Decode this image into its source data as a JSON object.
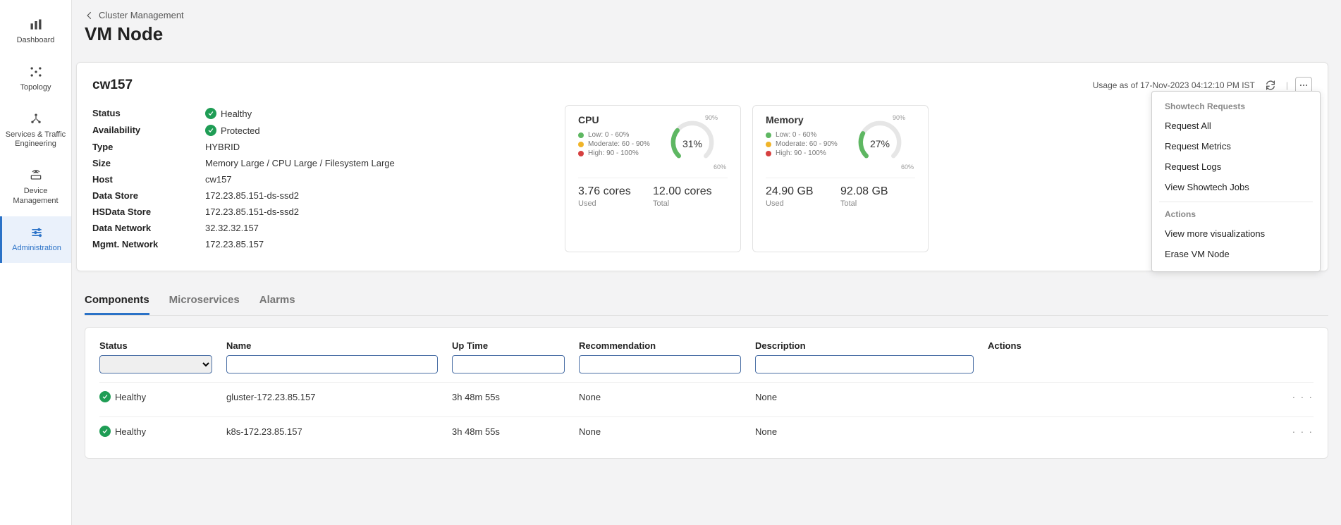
{
  "breadcrumb": "Cluster Management",
  "page_title": "VM Node",
  "sidebar": {
    "items": [
      {
        "label": "Dashboard"
      },
      {
        "label": "Topology"
      },
      {
        "label": "Services & Traffic Engineering"
      },
      {
        "label": "Device Management"
      },
      {
        "label": "Administration"
      }
    ],
    "active_index": 4
  },
  "node": {
    "name": "cw157",
    "usage_as_of": "Usage as of 17-Nov-2023 04:12:10 PM IST",
    "details": [
      {
        "k": "Status",
        "v": "Healthy",
        "chip": true
      },
      {
        "k": "Availability",
        "v": "Protected",
        "chip": true
      },
      {
        "k": "Type",
        "v": "HYBRID"
      },
      {
        "k": "Size",
        "v": "Memory Large / CPU Large / Filesystem Large"
      },
      {
        "k": "Host",
        "v": "cw157"
      },
      {
        "k": "Data Store",
        "v": "172.23.85.151-ds-ssd2"
      },
      {
        "k": "HSData Store",
        "v": "172.23.85.151-ds-ssd2"
      },
      {
        "k": "Data Network",
        "v": "32.32.32.157"
      },
      {
        "k": "Mgmt. Network",
        "v": "172.23.85.157"
      }
    ]
  },
  "legend": {
    "low": "Low: 0 - 60%",
    "mod": "Moderate: 60 - 90%",
    "high": "High: 90 - 100%"
  },
  "gauges": [
    {
      "title": "CPU",
      "percent": 31,
      "percent_label": "31%",
      "top_label": "90%",
      "bottom_label": "60%",
      "used_value": "3.76 cores",
      "used_label": "Used",
      "total_value": "12.00 cores",
      "total_label": "Total"
    },
    {
      "title": "Memory",
      "percent": 27,
      "percent_label": "27%",
      "top_label": "90%",
      "bottom_label": "60%",
      "used_value": "24.90 GB",
      "used_label": "Used",
      "total_value": "92.08 GB",
      "total_label": "Total"
    }
  ],
  "menu": {
    "section1_header": "Showtech Requests",
    "section1": [
      "Request All",
      "Request Metrics",
      "Request Logs",
      "View Showtech Jobs"
    ],
    "section2_header": "Actions",
    "section2": [
      "View more visualizations",
      "Erase VM Node"
    ]
  },
  "tabs": [
    {
      "label": "Components",
      "active": true
    },
    {
      "label": "Microservices"
    },
    {
      "label": "Alarms"
    }
  ],
  "columns": {
    "status": "Status",
    "name": "Name",
    "up": "Up Time",
    "reco": "Recommendation",
    "desc": "Description",
    "act": "Actions"
  },
  "rows": [
    {
      "status": "Healthy",
      "name": "gluster-172.23.85.157",
      "up": "3h 48m 55s",
      "reco": "None",
      "desc": "None"
    },
    {
      "status": "Healthy",
      "name": "k8s-172.23.85.157",
      "up": "3h 48m 55s",
      "reco": "None",
      "desc": "None"
    }
  ],
  "chart_data": [
    {
      "type": "gauge",
      "title": "CPU",
      "value": 31,
      "unit": "%",
      "thresholds": [
        60,
        90
      ],
      "range": [
        0,
        100
      ],
      "used": 3.76,
      "total": 12.0,
      "value_unit": "cores"
    },
    {
      "type": "gauge",
      "title": "Memory",
      "value": 27,
      "unit": "%",
      "thresholds": [
        60,
        90
      ],
      "range": [
        0,
        100
      ],
      "used": 24.9,
      "total": 92.08,
      "value_unit": "GB"
    }
  ]
}
